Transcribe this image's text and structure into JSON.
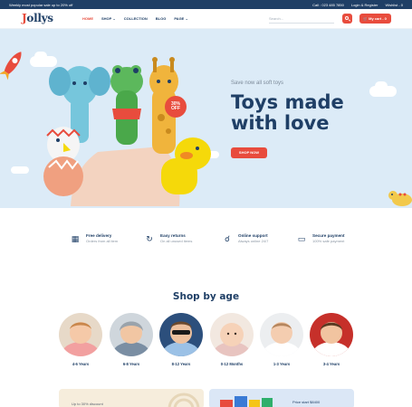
{
  "topbar": {
    "promo": "Weekly most popular sale up to 20% off",
    "call": "Call : 023 485 7850",
    "login": "Login & Register",
    "wishlist": "Wishlist - 0"
  },
  "header": {
    "logo_j": "J",
    "logo_rest": "ollys",
    "nav": [
      {
        "label": "HOME",
        "active": true
      },
      {
        "label": "SHOP",
        "dropdown": true
      },
      {
        "label": "COLLECTION"
      },
      {
        "label": "BLOG"
      },
      {
        "label": "PAGE",
        "dropdown": true
      }
    ],
    "search_placeholder": "Search...",
    "cart_label": "My cart - 0"
  },
  "hero": {
    "subtitle": "Save now all soft toys",
    "title": "Toys made with love",
    "cta": "SHOP NOW",
    "badge_percent": "30%",
    "badge_off": "OFF"
  },
  "features": [
    {
      "title": "Free delivery",
      "desc": "Orders from all item",
      "icon": "package-icon"
    },
    {
      "title": "Easy returns",
      "desc": "On all unused items",
      "icon": "refresh-icon"
    },
    {
      "title": "Online support",
      "desc": "Always online 24/7",
      "icon": "headset-icon"
    },
    {
      "title": "Secure payment",
      "desc": "100% safe payment",
      "icon": "card-icon"
    }
  ],
  "shop_by_age": {
    "title": "Shop by age",
    "items": [
      {
        "label": "4-6 Years"
      },
      {
        "label": "6-8 Years"
      },
      {
        "label": "8-12 Years"
      },
      {
        "label": "0-12 Months"
      },
      {
        "label": "1-3 Years"
      },
      {
        "label": "3-4 Years"
      }
    ]
  },
  "banners": {
    "left_text": "Up to 30% discount",
    "right_text": "Price start $8400"
  },
  "colors": {
    "primary": "#1f3f66",
    "accent": "#e84c3d",
    "hero_bg": "#dcebf7"
  }
}
